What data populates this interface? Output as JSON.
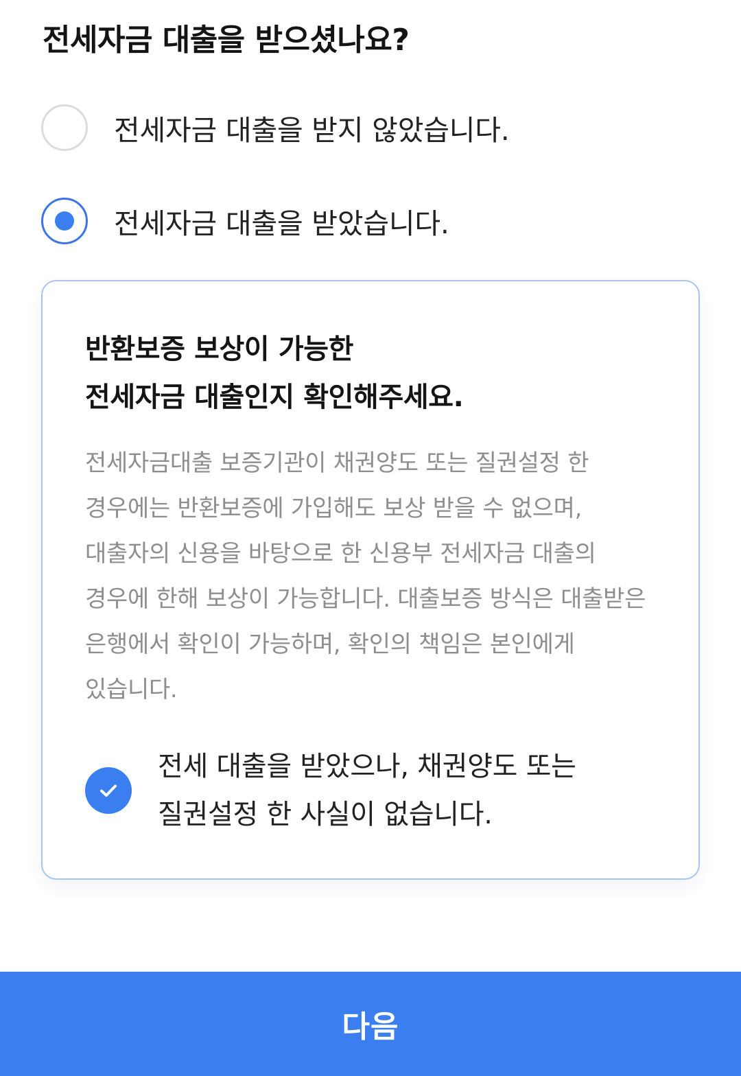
{
  "question": {
    "title": "전세자금 대출을 받으셨나요?"
  },
  "options": [
    {
      "label": "전세자금 대출을 받지 않았습니다.",
      "selected": false
    },
    {
      "label": "전세자금 대출을 받았습니다.",
      "selected": true
    }
  ],
  "info_box": {
    "title_line1": "반환보증 보상이 가능한",
    "title_line2": "전세자금 대출인지 확인해주세요.",
    "description": "전세자금대출 보증기관이 채권양도 또는 질권설정 한 경우에는 반환보증에 가입해도 보상 받을 수 없으며, 대출자의 신용을 바탕으로 한 신용부 전세자금 대출의 경우에 한해 보상이 가능합니다. 대출보증 방식은 대출받은 은행에서 확인이 가능하며, 확인의 책임은 본인에게 있습니다.",
    "confirm_line1": "전세 대출을 받았으나, 채권양도 또는",
    "confirm_line2": "질권설정 한 사실이 없습니다.",
    "confirm_checked": true,
    "confirm_icon": "checkmark-icon"
  },
  "footer": {
    "next_label": "다음"
  },
  "colors": {
    "accent": "#3b7ef0",
    "box_border": "#a9c4ec",
    "desc_text": "#8e8e8e",
    "radio_border": "#dcdcdc"
  }
}
